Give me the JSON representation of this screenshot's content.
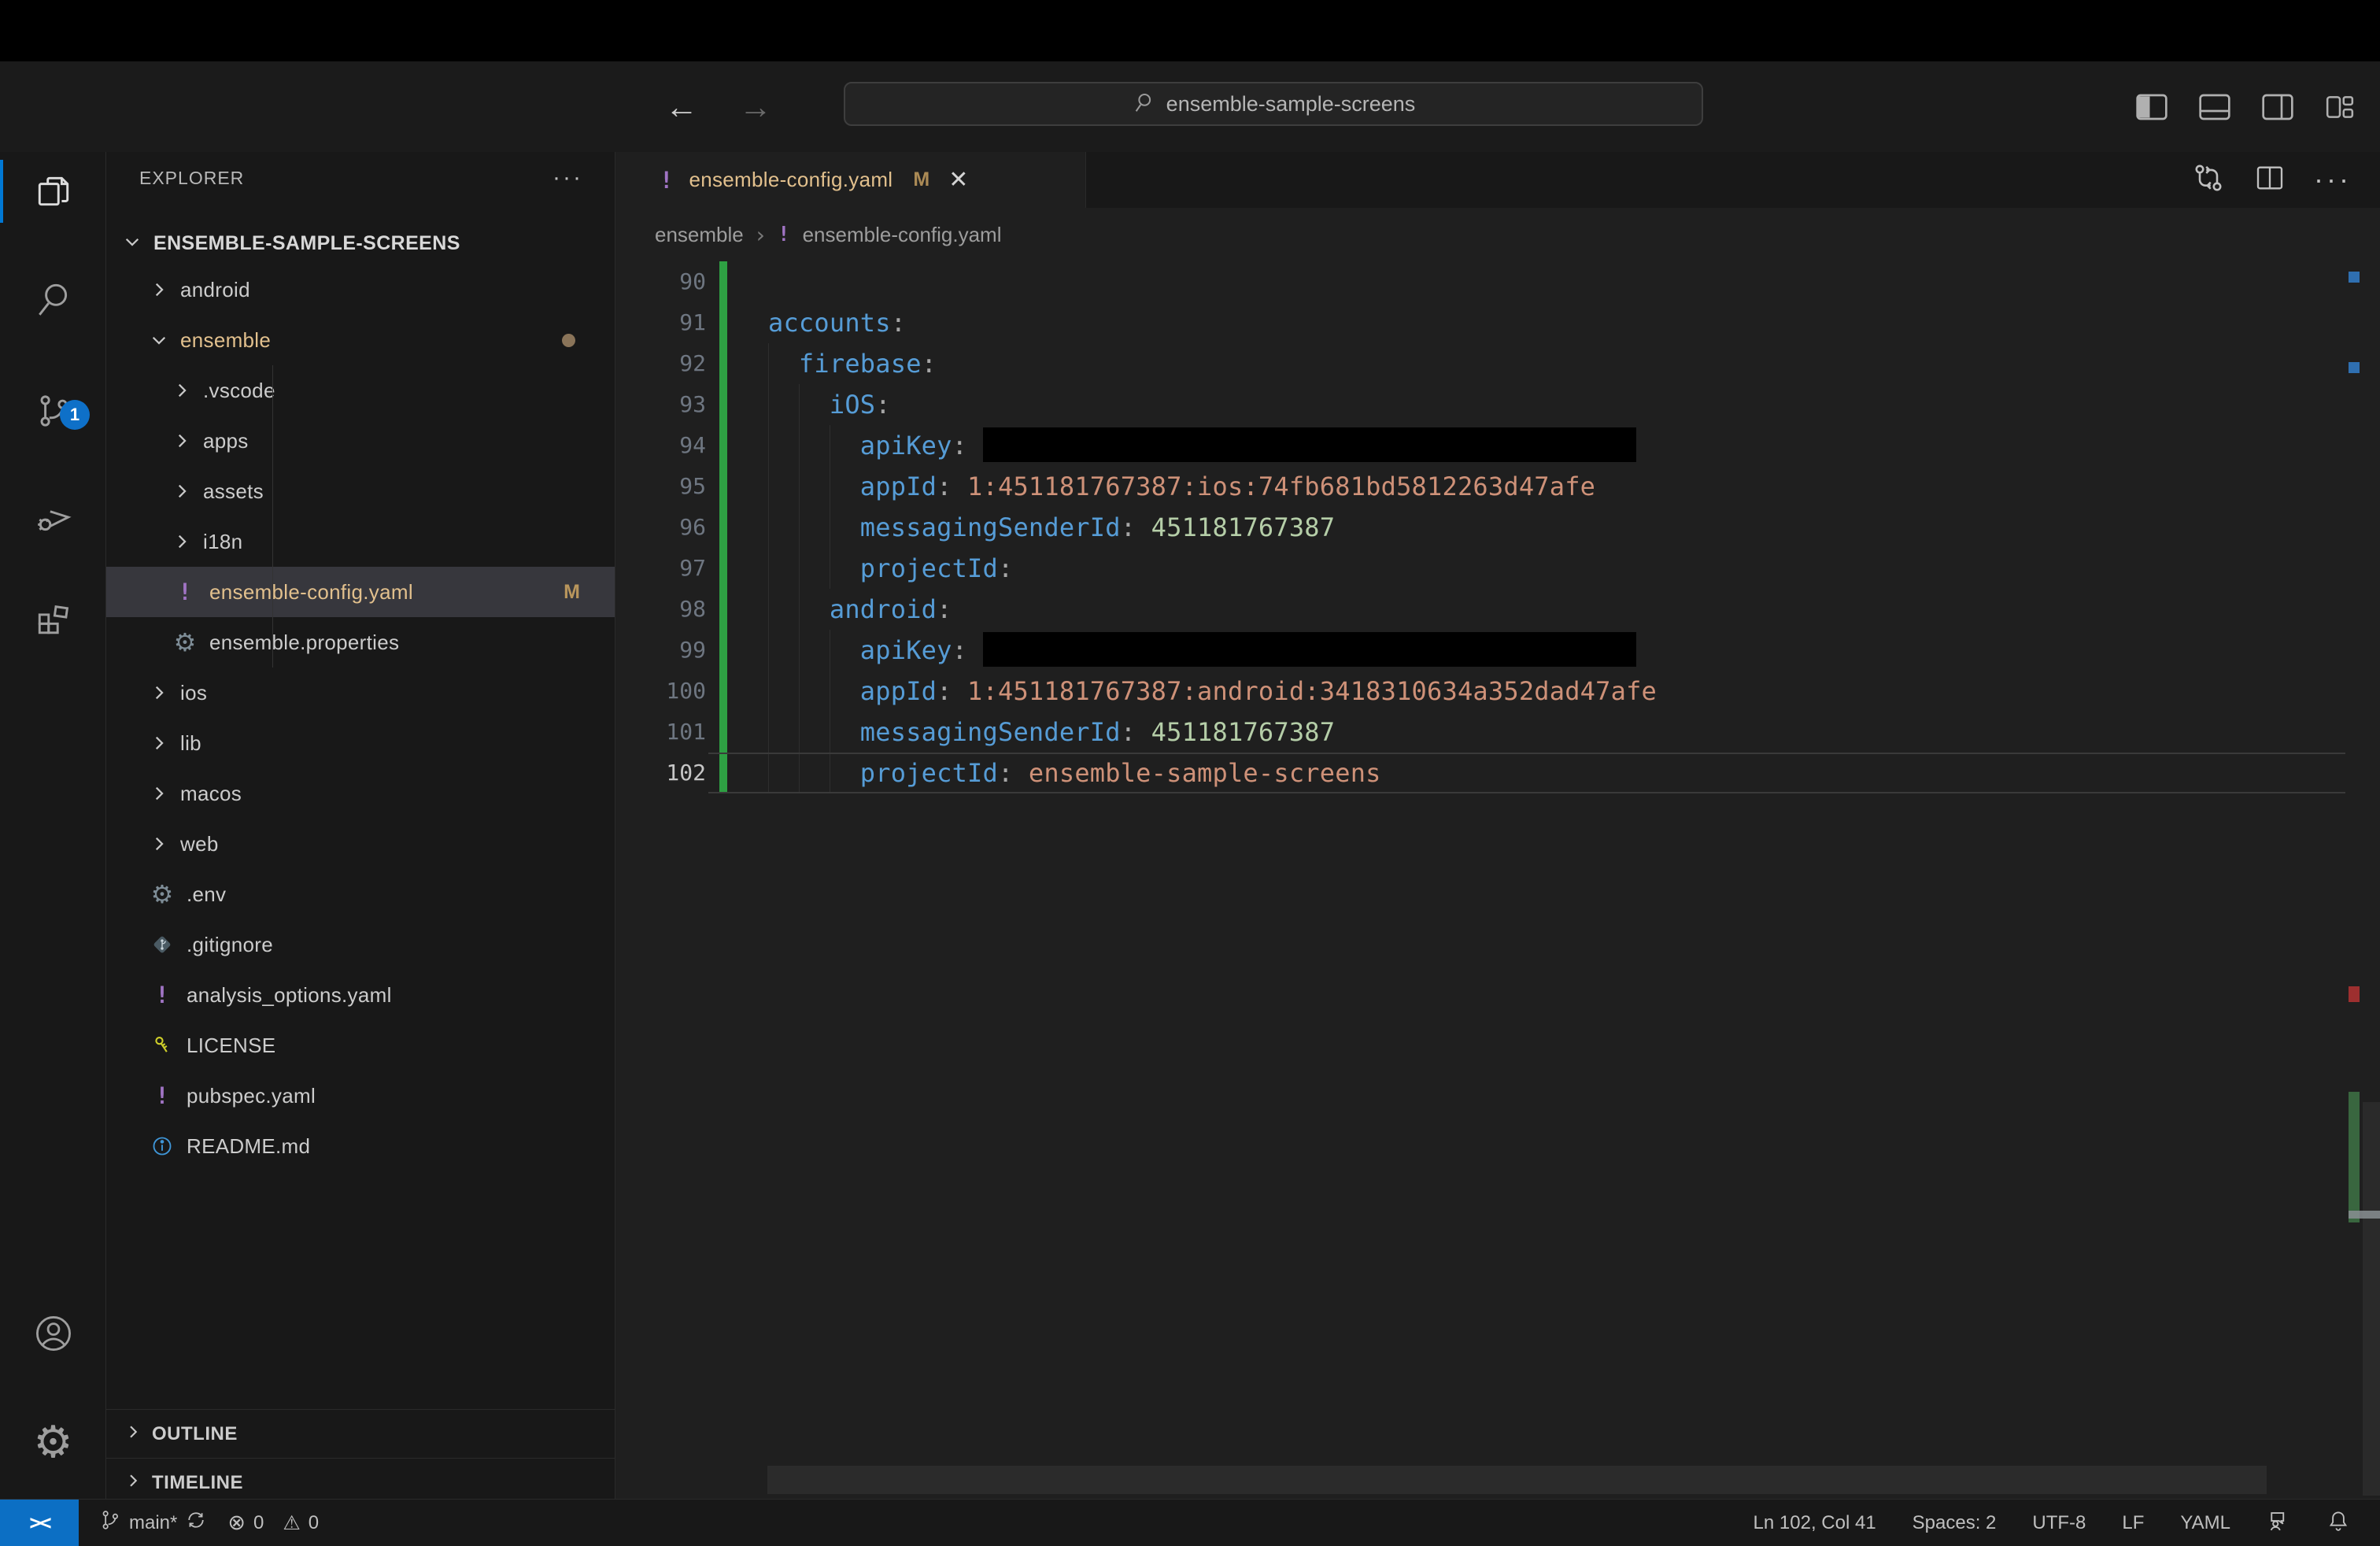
{
  "titlebar": {
    "command_center": "ensemble-sample-screens",
    "back_label": "←",
    "forward_label": "→"
  },
  "activity_bar": {
    "items": [
      "explorer",
      "search",
      "source-control",
      "run-and-debug",
      "extensions"
    ],
    "source_control_badge": "1"
  },
  "sidebar": {
    "title": "EXPLORER",
    "more_label": "···",
    "project": "ENSEMBLE-SAMPLE-SCREENS",
    "tree": [
      {
        "label": "android",
        "kind": "folder",
        "level": 0,
        "icon": "chevron-right"
      },
      {
        "label": "ensemble",
        "kind": "folder",
        "level": 0,
        "icon": "chevron-down",
        "modified": true,
        "dot": true
      },
      {
        "label": ".vscode",
        "kind": "folder",
        "level": 1,
        "icon": "chevron-right"
      },
      {
        "label": "apps",
        "kind": "folder",
        "level": 1,
        "icon": "chevron-right"
      },
      {
        "label": "assets",
        "kind": "folder",
        "level": 1,
        "icon": "chevron-right"
      },
      {
        "label": "i18n",
        "kind": "folder",
        "level": 1,
        "icon": "chevron-right"
      },
      {
        "label": "ensemble-config.yaml",
        "kind": "file",
        "level": 1,
        "icon": "yaml-icon",
        "modified": true,
        "badge": "M",
        "selected": true
      },
      {
        "label": "ensemble.properties",
        "kind": "file",
        "level": 1,
        "icon": "gear-icon"
      },
      {
        "label": "ios",
        "kind": "folder",
        "level": 0,
        "icon": "chevron-right"
      },
      {
        "label": "lib",
        "kind": "folder",
        "level": 0,
        "icon": "chevron-right"
      },
      {
        "label": "macos",
        "kind": "folder",
        "level": 0,
        "icon": "chevron-right"
      },
      {
        "label": "web",
        "kind": "folder",
        "level": 0,
        "icon": "chevron-right"
      },
      {
        "label": ".env",
        "kind": "file",
        "level": 0,
        "icon": "gear-icon"
      },
      {
        "label": ".gitignore",
        "kind": "file",
        "level": 0,
        "icon": "git-icon"
      },
      {
        "label": "analysis_options.yaml",
        "kind": "file",
        "level": 0,
        "icon": "yaml-icon"
      },
      {
        "label": "LICENSE",
        "kind": "file",
        "level": 0,
        "icon": "key-icon"
      },
      {
        "label": "pubspec.yaml",
        "kind": "file",
        "level": 0,
        "icon": "yaml-icon"
      },
      {
        "label": "README.md",
        "kind": "file",
        "level": 0,
        "icon": "info-icon"
      }
    ],
    "sections": [
      {
        "label": "OUTLINE"
      },
      {
        "label": "TIMELINE"
      }
    ]
  },
  "editor": {
    "tab": {
      "label": "ensemble-config.yaml",
      "badge": "M",
      "close": "✕",
      "icon": "yaml-icon"
    },
    "breadcrumbs": [
      {
        "label": "ensemble"
      },
      {
        "label": "ensemble-config.yaml",
        "icon": "yaml-icon"
      }
    ],
    "breadcrumb_sep": "›",
    "lines": [
      {
        "num": 90,
        "indent": 0,
        "key": ""
      },
      {
        "num": 91,
        "indent": 0,
        "key": "accounts"
      },
      {
        "num": 92,
        "indent": 2,
        "key": "firebase"
      },
      {
        "num": 93,
        "indent": 4,
        "key": "iOS"
      },
      {
        "num": 94,
        "indent": 6,
        "key": "apiKey",
        "redacted": true
      },
      {
        "num": 95,
        "indent": 6,
        "key": "appId",
        "value": "1:451181767387:ios:74fb681bd5812263d47afe",
        "vtype": "string"
      },
      {
        "num": 96,
        "indent": 6,
        "key": "messagingSenderId",
        "value": "451181767387",
        "vtype": "number"
      },
      {
        "num": 97,
        "indent": 6,
        "key": "projectId"
      },
      {
        "num": 98,
        "indent": 4,
        "key": "android"
      },
      {
        "num": 99,
        "indent": 6,
        "key": "apiKey",
        "redacted": true
      },
      {
        "num": 100,
        "indent": 6,
        "key": "appId",
        "value": "1:451181767387:android:3418310634a352dad47afe",
        "vtype": "string"
      },
      {
        "num": 101,
        "indent": 6,
        "key": "messagingSenderId",
        "value": "451181767387",
        "vtype": "number"
      },
      {
        "num": 102,
        "indent": 6,
        "key": "projectId",
        "value": "ensemble-sample-screens",
        "vtype": "string",
        "current": true
      }
    ]
  },
  "status_bar": {
    "remote": "><",
    "branch": "main*",
    "errors": "0",
    "warnings": "0",
    "error_icon": "⊗",
    "warning_icon": "⚠",
    "cursor": "Ln 102, Col 41",
    "indentation": "Spaces: 2",
    "encoding": "UTF-8",
    "eol": "LF",
    "language": "YAML"
  },
  "colors": {
    "accent_blue": "#0078d4",
    "modified_tan": "#e2c08d",
    "added_green": "#2ea043",
    "yaml_key_blue": "#569cd6",
    "string_orange": "#ce9178",
    "number_green": "#b5cea8"
  }
}
